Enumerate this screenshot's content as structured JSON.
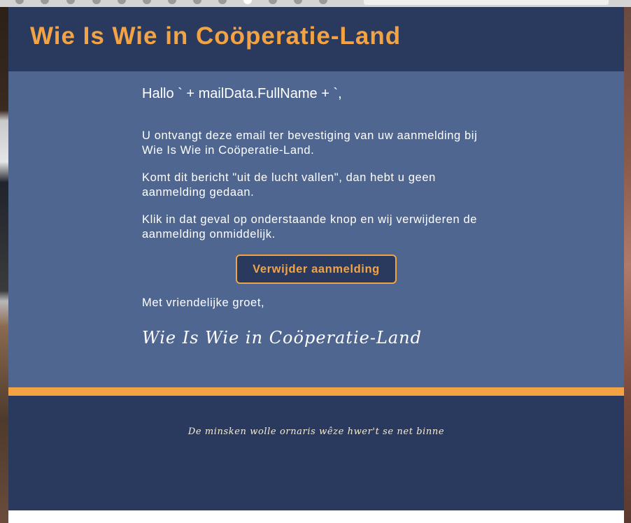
{
  "header": {
    "title": "Wie Is Wie in Coöperatie-Land"
  },
  "email": {
    "greeting": "Hallo ` + mailData.FullName + `,",
    "paragraphs": [
      "U ontvangt deze email ter bevestiging van uw aanmelding bij Wie Is Wie in Coöperatie-Land.",
      "Komt dit bericht \"uit de lucht vallen\", dan hebt u geen aanmelding gedaan.",
      "Klik in dat geval op onderstaande knop en wij verwijderen de aanmelding onmiddelijk."
    ],
    "button_label": "Verwijder aanmelding",
    "closing": "Met vriendelijke groet,",
    "signature": "Wie Is Wie in Coöperatie-Land"
  },
  "footer": {
    "motto": "De minsken wolle ornaris wêze hwer't se net binne"
  },
  "colors": {
    "header_bg": "#2a3a5f",
    "content_bg": "#4f6691",
    "accent": "#f3a343",
    "text": "#ffffff"
  }
}
